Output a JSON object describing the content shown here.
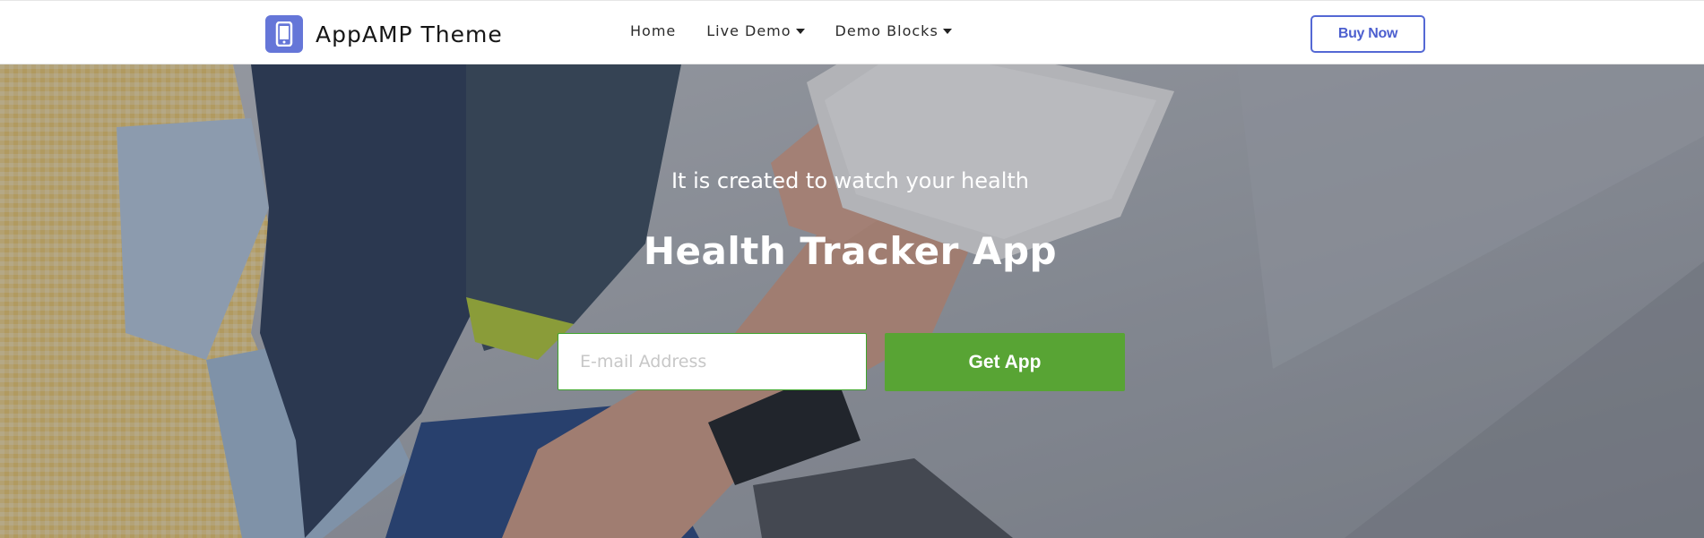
{
  "header": {
    "brand_name": "AppAMP Theme",
    "nav": [
      {
        "label": "Home",
        "dropdown": false
      },
      {
        "label": "Live Demo",
        "dropdown": true
      },
      {
        "label": "Demo Blocks",
        "dropdown": true
      }
    ],
    "buy_label": "Buy Now"
  },
  "hero": {
    "tagline": "It is created to watch your health",
    "title": "Health Tracker App",
    "email_placeholder": "E-mail Address",
    "cta_label": "Get App"
  },
  "colors": {
    "brand": "#6576d8",
    "buy_border": "#5468d4",
    "cta": "#58a434"
  }
}
